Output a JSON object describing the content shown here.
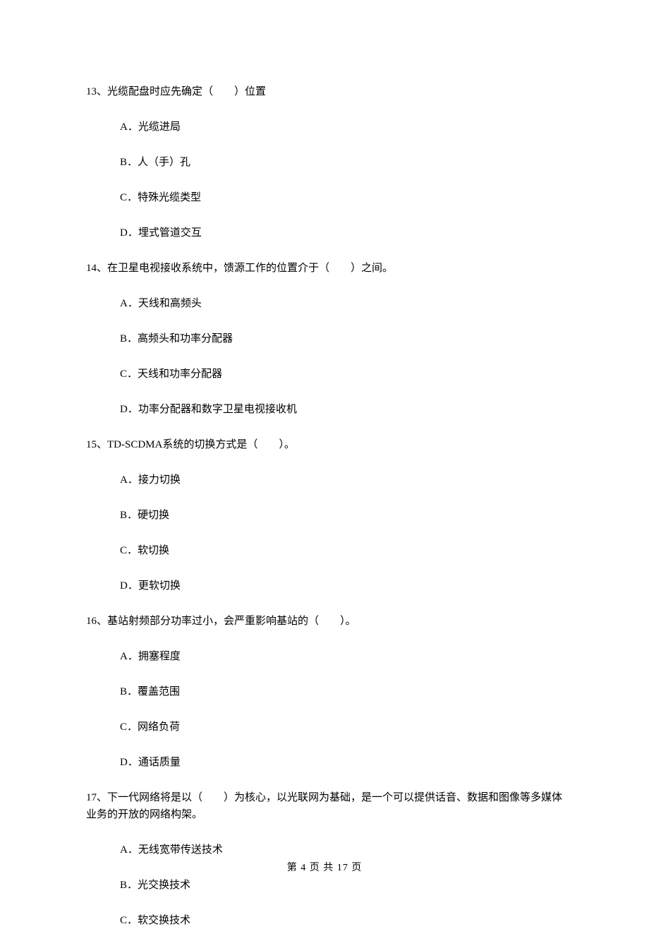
{
  "questions": [
    {
      "stem": "13、光缆配盘时应先确定（　　）位置",
      "options": [
        "A．光缆进局",
        "B．人（手）孔",
        "C．特殊光缆类型",
        "D．埋式管道交互"
      ]
    },
    {
      "stem": "14、在卫星电视接收系统中，馈源工作的位置介于（　　）之间。",
      "options": [
        "A．天线和高频头",
        "B．高频头和功率分配器",
        "C．天线和功率分配器",
        "D．功率分配器和数字卫星电视接收机"
      ]
    },
    {
      "stem": "15、TD-SCDMA系统的切换方式是（　　）。",
      "options": [
        "A．接力切换",
        "B．硬切换",
        "C．软切换",
        "D．更软切换"
      ]
    },
    {
      "stem": "16、基站射频部分功率过小，会严重影响基站的（　　）。",
      "options": [
        "A．拥塞程度",
        "B．覆盖范围",
        "C．网络负荷",
        "D．通话质量"
      ]
    },
    {
      "stem": "17、下一代网络将是以（　　）为核心，以光联网为基础，是一个可以提供话音、数据和图像等多媒体业务的开放的网络构架。",
      "options": [
        "A．无线宽带传送技术",
        "B．光交换技术",
        "C．软交换技术"
      ]
    }
  ],
  "footer": "第 4 页 共 17 页"
}
